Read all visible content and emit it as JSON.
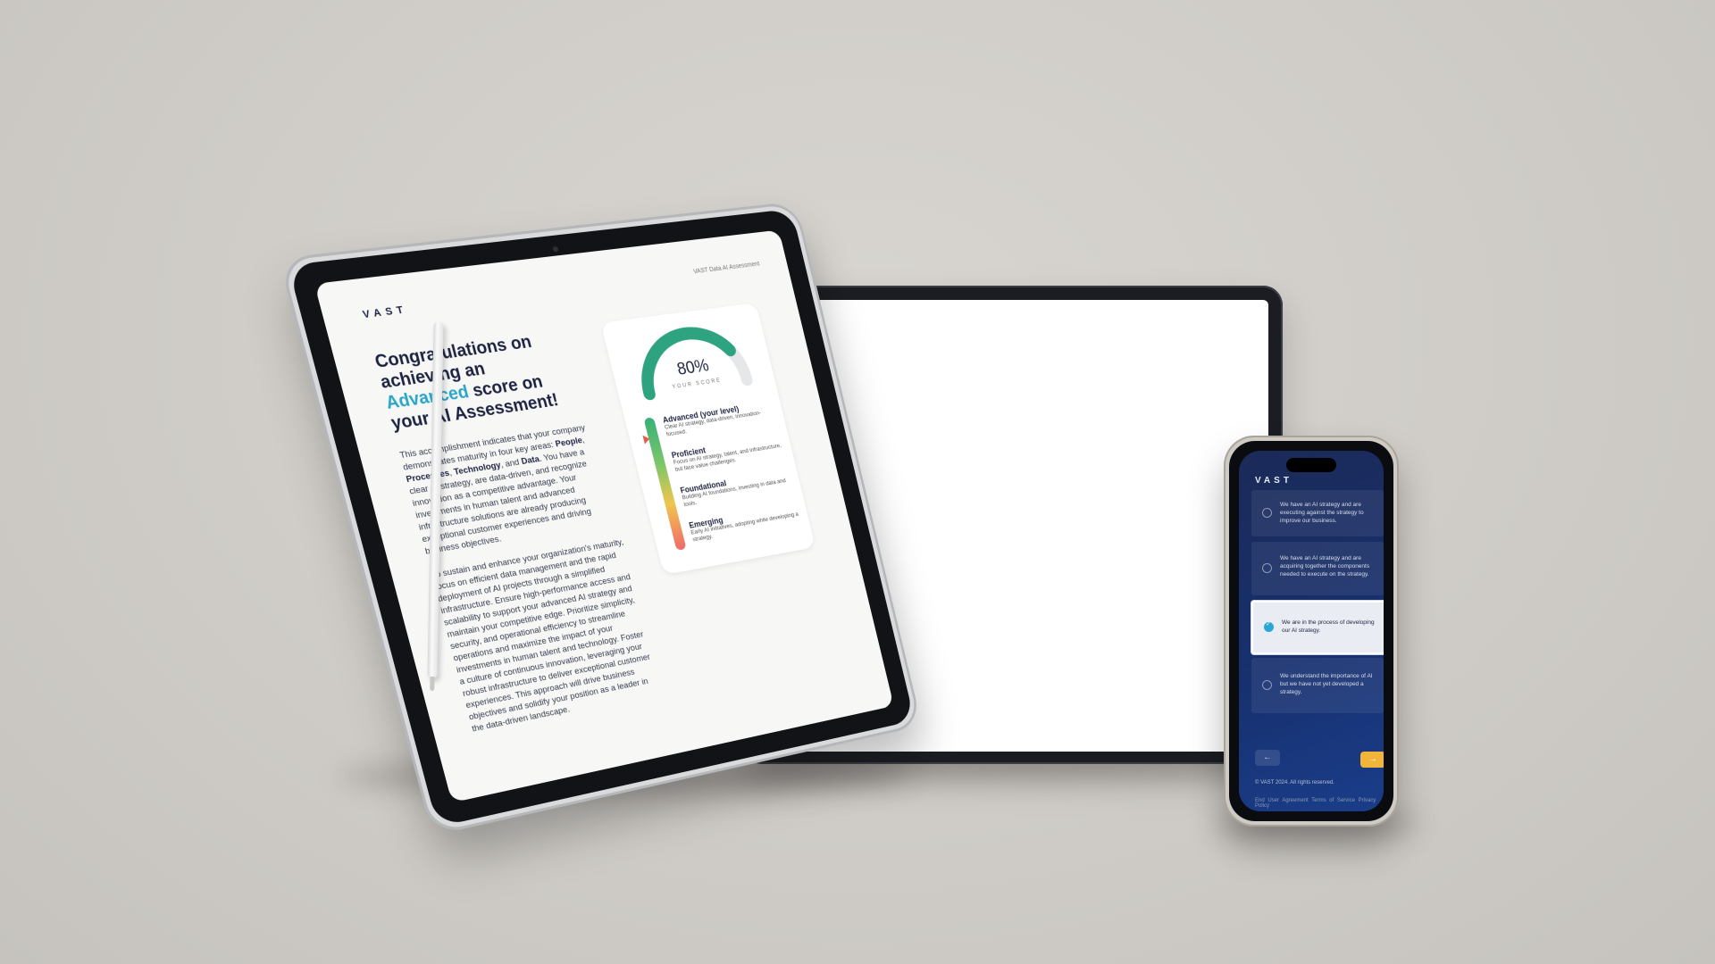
{
  "colors": {
    "background": "#cfccc7",
    "accent": "#2aa6c8",
    "navy": "#1c2340",
    "phone_bg": "#17306e",
    "next_button": "#f1b53a"
  },
  "tablet": {
    "brand": "VAST",
    "header_label": "VAST Data AI Assessment",
    "title_part1": "Congratulations on achieving an ",
    "title_accent": "Advanced",
    "title_part2": " score on your AI Assessment!",
    "paragraph1_a": "This accomplishment indicates that your company demonstrates maturity in four key areas: ",
    "paragraph1_people": "People",
    "paragraph1_sep1": ", ",
    "paragraph1_processes": "Processes",
    "paragraph1_sep2": ", ",
    "paragraph1_technology": "Technology",
    "paragraph1_sep3": ", and ",
    "paragraph1_data": "Data",
    "paragraph1_b": ". You have a clear AI strategy, are data-driven, and recognize innovation as a competitive advantage. Your investments in human talent and advanced infrastructure solutions are already producing exceptional customer experiences and driving business objectives.",
    "paragraph2": "To sustain and enhance your organization's maturity, focus on efficient data management and the rapid deployment of AI projects through a simplified infrastructure. Ensure high-performance access and scalability to support your advanced AI strategy and maintain your competitive edge. Prioritize simplicity, security, and operational efficiency to streamline operations and maximize the impact of your investments in human talent and technology. Foster a culture of continuous innovation, leveraging your robust infrastructure to deliver exceptional customer experiences. This approach will drive business objectives and solidify your position as a leader in the data-driven landscape.",
    "score": {
      "value_label": "80%",
      "value": 0.8,
      "caption": "YOUR SCORE"
    },
    "levels": [
      {
        "name": "Advanced (your level)",
        "desc": "Clear AI strategy, data-driven, innovation-focused."
      },
      {
        "name": "Proficient",
        "desc": "Focus on AI strategy, talent, and infrastructure, but face value challenges."
      },
      {
        "name": "Foundational",
        "desc": "Building AI foundations, investing in data and tools."
      },
      {
        "name": "Emerging",
        "desc": "Early AI initiatives, adopting while developing a strategy."
      }
    ]
  },
  "phone": {
    "brand": "VAST",
    "options": [
      {
        "text": "We have an AI strategy and are executing against the strategy to improve our business.",
        "selected": false
      },
      {
        "text": "We have an AI strategy and are acquiring together the components needed to execute on the strategy.",
        "selected": false
      },
      {
        "text": "We are in the process of developing our AI strategy.",
        "selected": true
      },
      {
        "text": "We understand the importance of AI but we have not yet developed a strategy.",
        "selected": false
      }
    ],
    "back_icon": "←",
    "next_icon": "→",
    "copyright": "© VAST 2024. All rights reserved.",
    "links": [
      "End User Agreement",
      "Terms of Service",
      "Privacy Policy"
    ]
  }
}
